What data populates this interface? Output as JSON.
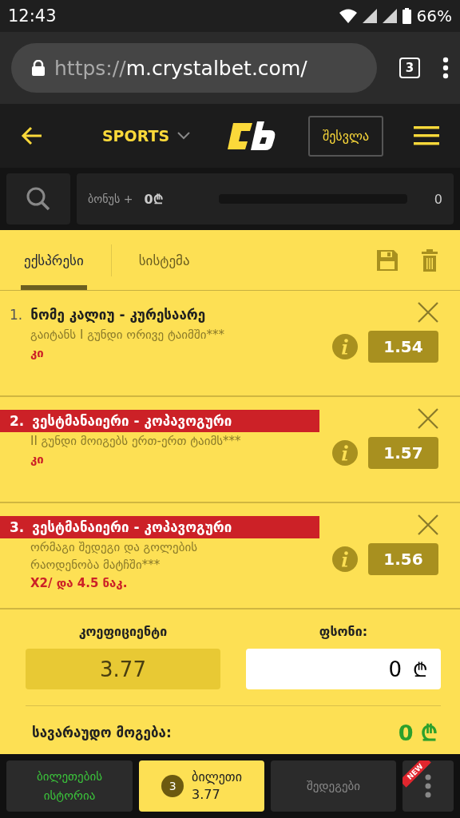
{
  "status_bar": {
    "time": "12:43",
    "battery": "66%"
  },
  "browser": {
    "url_scheme": "https://",
    "url_host": "m.crystalbet.com/",
    "tab_count": "3"
  },
  "header": {
    "sport": "SPORTS",
    "login": "შესვლა"
  },
  "bonus": {
    "label": "ბონუს +",
    "amount": "0₾",
    "level": 0,
    "count": "0"
  },
  "tabs": [
    {
      "label": "ექსპრესი",
      "selected": true
    },
    {
      "label": "სისტემა",
      "selected": false
    }
  ],
  "bets": [
    {
      "number": "1.",
      "match": "ნომე კალიუ - კურესაარე",
      "market": "გაიტანს I გუნდი ორივე ტაიმში***",
      "pick": "კი",
      "odds": "1.54",
      "highlighted": false
    },
    {
      "number": "2.",
      "match": "ვესტმანაიერი - კოპავოგური",
      "market": "II გუნდი მოიგებს ერთ-ერთ ტაიმს***",
      "pick": "კი",
      "odds": "1.57",
      "highlighted": true
    },
    {
      "number": "3.",
      "match": "ვესტმანაიერი - კოპავოგური",
      "market": "ორმაგი შედეგი და გოლების რაოდენობა მატჩში***",
      "pick": "X2/ და 4.5 ნაკ.",
      "odds": "1.56",
      "highlighted": true
    }
  ],
  "summary": {
    "coef_label": "კოეფიციენტი",
    "coef_value": "3.77",
    "stake_label": "ფსონი:",
    "stake_value": "0",
    "stake_currency": "₾",
    "win_label": "სავარაუდო მოგება:",
    "win_value": "0 ₾"
  },
  "bottom_nav": {
    "history": "ბილეთების ისტორია",
    "ticket_count": "3",
    "ticket_label": "ბილეთი",
    "ticket_value": "3.77",
    "results": "შედეგები",
    "new_badge": "NEW"
  }
}
